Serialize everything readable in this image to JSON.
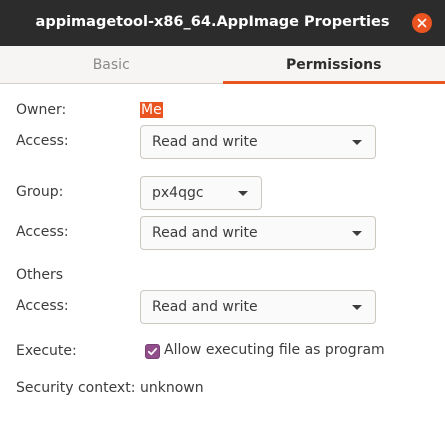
{
  "window": {
    "title": "appimagetool-x86_64.AppImage Properties"
  },
  "tabs": [
    {
      "label": "Basic",
      "active": false
    },
    {
      "label": "Permissions",
      "active": true
    }
  ],
  "owner": {
    "label": "Owner:",
    "value": "Me",
    "access_label": "Access:",
    "access_value": "Read and write"
  },
  "group": {
    "label": "Group:",
    "value": "px4qgc",
    "access_label": "Access:",
    "access_value": "Read and write"
  },
  "others": {
    "label": "Others",
    "access_label": "Access:",
    "access_value": "Read and write"
  },
  "execute": {
    "label": "Execute:",
    "checkbox_label": "Allow executing file as program",
    "checked": true
  },
  "security": {
    "label": "Security context:",
    "value": "unknown"
  },
  "colors": {
    "accent": "#e95420",
    "checkbox": "#924d8b",
    "titlebar": "#2c2c2c"
  }
}
